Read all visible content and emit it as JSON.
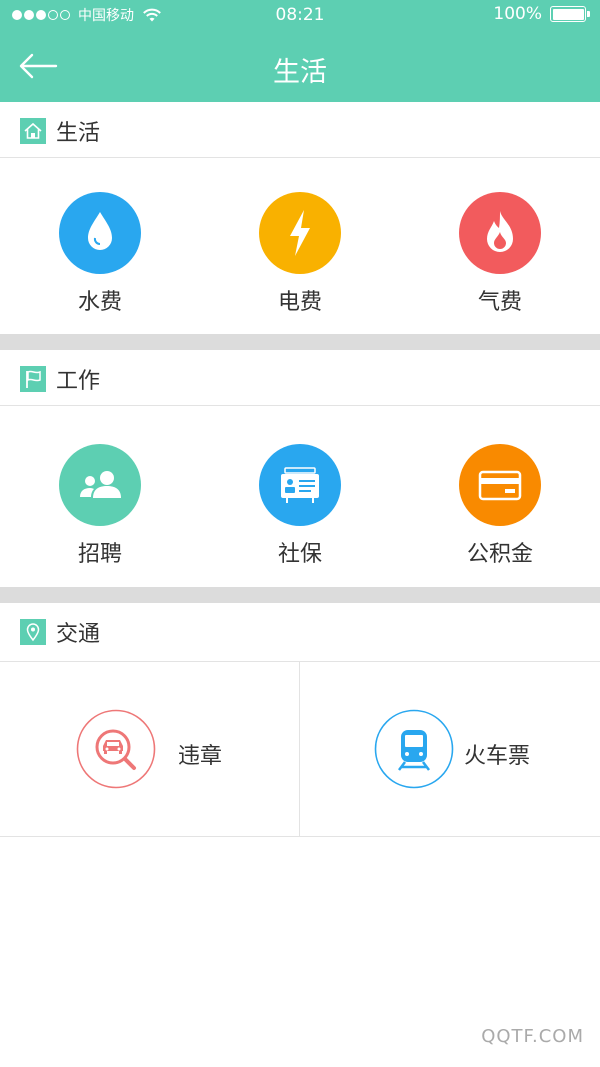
{
  "status_bar": {
    "carrier": "中国移动",
    "time": "08:21",
    "battery": "100%",
    "signal_level": 3,
    "signal_total": 5
  },
  "nav": {
    "title": "生活"
  },
  "sections": {
    "life": {
      "title": "生活",
      "items": [
        {
          "label": "水费",
          "icon": "water-drop-icon",
          "color": "#29a7ef"
        },
        {
          "label": "电费",
          "icon": "lightning-icon",
          "color": "#f9b100"
        },
        {
          "label": "气费",
          "icon": "flame-icon",
          "color": "#f25b5d"
        }
      ]
    },
    "work": {
      "title": "工作",
      "items": [
        {
          "label": "招聘",
          "icon": "people-icon",
          "color": "#5dcfb2"
        },
        {
          "label": "社保",
          "icon": "id-card-icon",
          "color": "#29a7ef"
        },
        {
          "label": "公积金",
          "icon": "bank-card-icon",
          "color": "#f98a00"
        }
      ]
    },
    "traffic": {
      "title": "交通",
      "items": [
        {
          "label": "违章",
          "icon": "car-search-icon",
          "color": "#ee7777"
        },
        {
          "label": "火车票",
          "icon": "train-icon",
          "color": "#29a7ef"
        }
      ]
    }
  },
  "colors": {
    "primary": "#5dcfb2",
    "divider": "#dcdcdc"
  },
  "watermark": "QQTF.COM"
}
